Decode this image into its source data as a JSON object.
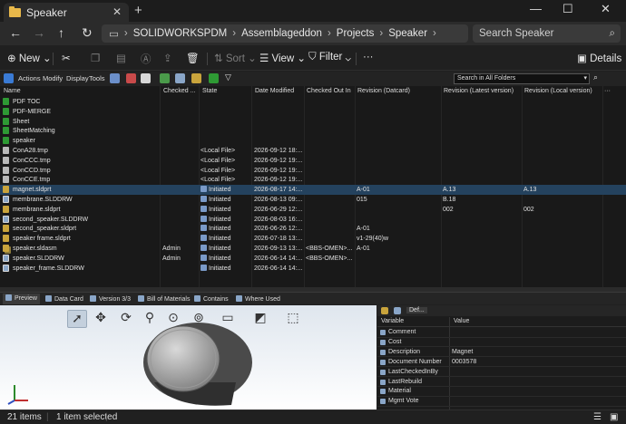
{
  "window": {
    "tab_title": "Speaker",
    "close": "✕",
    "new_tab": "+",
    "minimize": "—",
    "maximize": "☐",
    "close_window": "✕"
  },
  "address": {
    "crumbs": [
      "SOLIDWORKSPDM",
      "Assemblageddon",
      "Projects",
      "Speaker"
    ],
    "search_placeholder": "Search Speaker"
  },
  "commands": {
    "new": "New",
    "sort": "Sort",
    "view": "View",
    "filter": "Filter",
    "more": "···",
    "details": "Details"
  },
  "pdm": {
    "menus": [
      "Actions",
      "Modify",
      "Display",
      "Tools"
    ],
    "search_scope": "Search in All Folders"
  },
  "columns": [
    "Name",
    "Checked ...",
    "State",
    "Date Modified",
    "Checked Out In",
    "Revision (Datcard)",
    "Revision (Latest version)",
    "Revision (Local version)"
  ],
  "rows": [
    {
      "icon": "doc",
      "name": "PDF TOC",
      "checked": "",
      "state": "",
      "date": "",
      "out": "",
      "rev_d": "",
      "rev_l": "",
      "rev_loc": ""
    },
    {
      "icon": "doc",
      "name": "PDF-MERGE",
      "checked": "",
      "state": "",
      "date": "",
      "out": "",
      "rev_d": "",
      "rev_l": "",
      "rev_loc": ""
    },
    {
      "icon": "doc",
      "name": "Sheet",
      "checked": "",
      "state": "",
      "date": "",
      "out": "",
      "rev_d": "",
      "rev_l": "",
      "rev_loc": ""
    },
    {
      "icon": "doc",
      "name": "SheetMatching",
      "checked": "",
      "state": "",
      "date": "",
      "out": "",
      "rev_d": "",
      "rev_l": "",
      "rev_loc": ""
    },
    {
      "icon": "doc",
      "name": "speaker",
      "checked": "",
      "state": "",
      "date": "",
      "out": "",
      "rev_d": "",
      "rev_l": "",
      "rev_loc": ""
    },
    {
      "icon": "tmp",
      "name": "ConA28.tmp",
      "checked": "",
      "state": "<Local File>",
      "date": "2026-09-12 18:...",
      "out": "",
      "rev_d": "",
      "rev_l": "",
      "rev_loc": ""
    },
    {
      "icon": "tmp",
      "name": "ConCCC.tmp",
      "checked": "",
      "state": "<Local File>",
      "date": "2026-09-12 19:...",
      "out": "",
      "rev_d": "",
      "rev_l": "",
      "rev_loc": ""
    },
    {
      "icon": "tmp",
      "name": "ConCCD.tmp",
      "checked": "",
      "state": "<Local File>",
      "date": "2026-09-12 19:...",
      "out": "",
      "rev_d": "",
      "rev_l": "",
      "rev_loc": ""
    },
    {
      "icon": "tmp",
      "name": "ConCCE.tmp",
      "checked": "",
      "state": "<Local File>",
      "date": "2026-09-12 19:...",
      "out": "",
      "rev_d": "",
      "rev_l": "",
      "rev_loc": ""
    },
    {
      "icon": "part",
      "name": "magnet.sldprt",
      "checked": "",
      "state": "Initiated",
      "date": "2026-08-17 14:...",
      "out": "",
      "rev_d": "A-01",
      "rev_l": "A.13",
      "rev_loc": "A.13",
      "selected": true
    },
    {
      "icon": "drw",
      "name": "membrane.SLDDRW",
      "checked": "",
      "state": "Initiated",
      "date": "2026-08-13 09:...",
      "out": "",
      "rev_d": "015",
      "rev_l": "B.18",
      "rev_loc": ""
    },
    {
      "icon": "part",
      "name": "membrane.sldprt",
      "checked": "",
      "state": "Initiated",
      "date": "2026-06-29 12:...",
      "out": "",
      "rev_d": "",
      "rev_l": "002",
      "rev_loc": "002"
    },
    {
      "icon": "drw",
      "name": "second_speaker.SLDDRW",
      "checked": "",
      "state": "Initiated",
      "date": "2026-08-03 16:...",
      "out": "",
      "rev_d": "",
      "rev_l": "",
      "rev_loc": ""
    },
    {
      "icon": "part",
      "name": "second_speaker.sldprt",
      "checked": "",
      "state": "Initiated",
      "date": "2026-06-26 12:...",
      "out": "",
      "rev_d": "A-01",
      "rev_l": "",
      "rev_loc": ""
    },
    {
      "icon": "part",
      "name": "speaker frame.sldprt",
      "checked": "",
      "state": "Initiated",
      "date": "2026-07-18 13:...",
      "out": "",
      "rev_d": "v1-29(40)w",
      "rev_l": "",
      "rev_loc": ""
    },
    {
      "icon": "asm",
      "name": "speaker.sldasm",
      "checked": "Admin",
      "state": "Initiated",
      "date": "2026-09-13 13:...",
      "out": "<BBS-OMEN>...",
      "rev_d": "A-01",
      "rev_l": "",
      "rev_loc": ""
    },
    {
      "icon": "drw",
      "name": "speaker.SLDDRW",
      "checked": "Admin",
      "state": "Initiated",
      "date": "2026-06-14 14:...",
      "out": "<BBS-OMEN>...",
      "rev_d": "",
      "rev_l": "",
      "rev_loc": ""
    },
    {
      "icon": "drw",
      "name": "speaker_frame.SLDDRW",
      "checked": "",
      "state": "Initiated",
      "date": "2026-06-14 14:...",
      "out": "",
      "rev_d": "",
      "rev_l": "",
      "rev_loc": ""
    }
  ],
  "lower_tabs": [
    "Preview",
    "Data Card",
    "Version 3/3",
    "Bill of Materials",
    "Contains",
    "Where Used"
  ],
  "props": {
    "tab_label": "Def...",
    "col_variable": "Variable",
    "col_value": "Value",
    "rows": [
      {
        "name": "Comment",
        "value": ""
      },
      {
        "name": "Cost",
        "value": ""
      },
      {
        "name": "Description",
        "value": "Magnet"
      },
      {
        "name": "Document Number",
        "value": "0003578"
      },
      {
        "name": "LastCheckedInBy",
        "value": ""
      },
      {
        "name": "LastRebuild",
        "value": ""
      },
      {
        "name": "Material",
        "value": ""
      },
      {
        "name": "Mgmt Vote",
        "value": ""
      }
    ]
  },
  "status": {
    "items": "21 items",
    "selected": "1 item selected"
  }
}
